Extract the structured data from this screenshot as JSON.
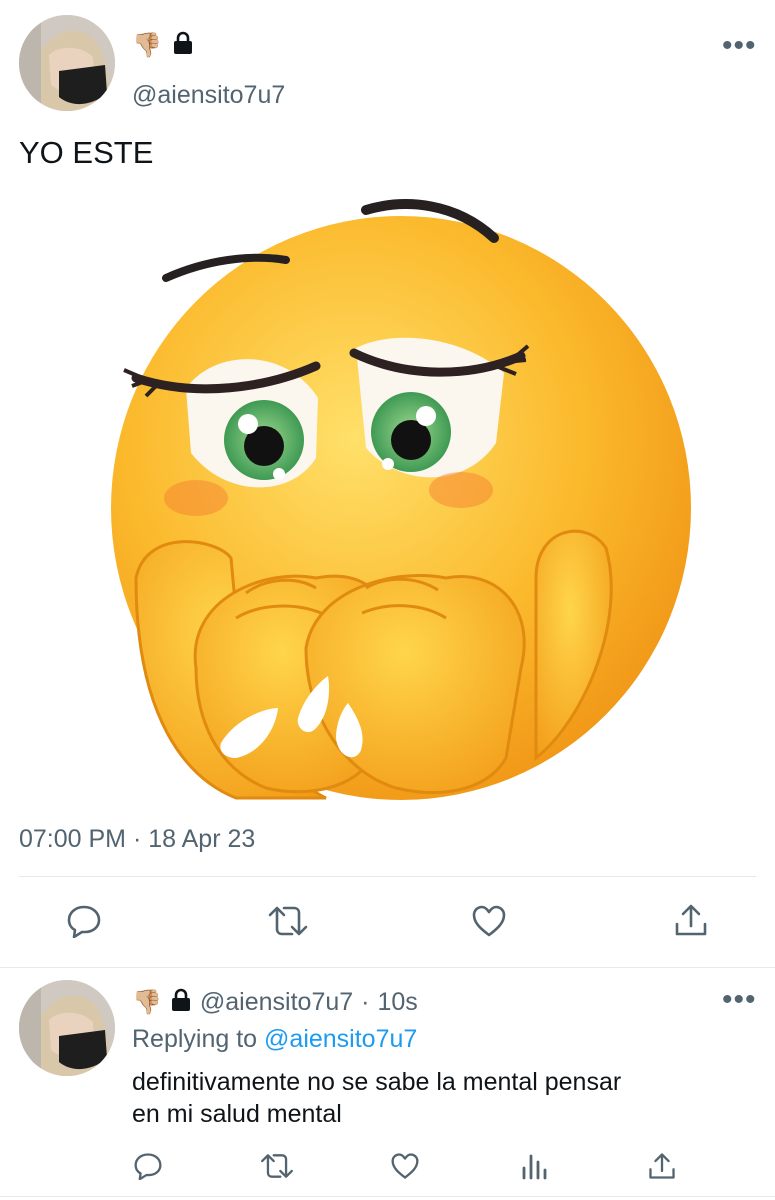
{
  "tweet": {
    "name_emoji": "👎🏼",
    "handle": "@aiensito7u7",
    "text": "YO ESTE",
    "time": "07:00 PM",
    "date_sep": "·",
    "date": "18 Apr 23",
    "more": "•••"
  },
  "reply": {
    "name_emoji": "👎🏼",
    "handle": "@aiensito7u7",
    "sep": "·",
    "age": "10s",
    "replying_prefix": "Replying to",
    "replying_to": "@aiensito7u7",
    "text_line1": "definitivamente no se sabe la mental pensar",
    "text_line2": "en mi salud mental",
    "more": "•••"
  },
  "icons": {
    "lock": "lock-icon",
    "reply": "reply-icon",
    "retweet": "retweet-icon",
    "like": "like-icon",
    "share": "share-icon",
    "analytics": "analytics-icon"
  },
  "colors": {
    "text": "#0f1419",
    "muted": "#536471",
    "link": "#1d9bf0",
    "divider": "#e6e9ec",
    "emoji_face": "#f7a51c"
  }
}
